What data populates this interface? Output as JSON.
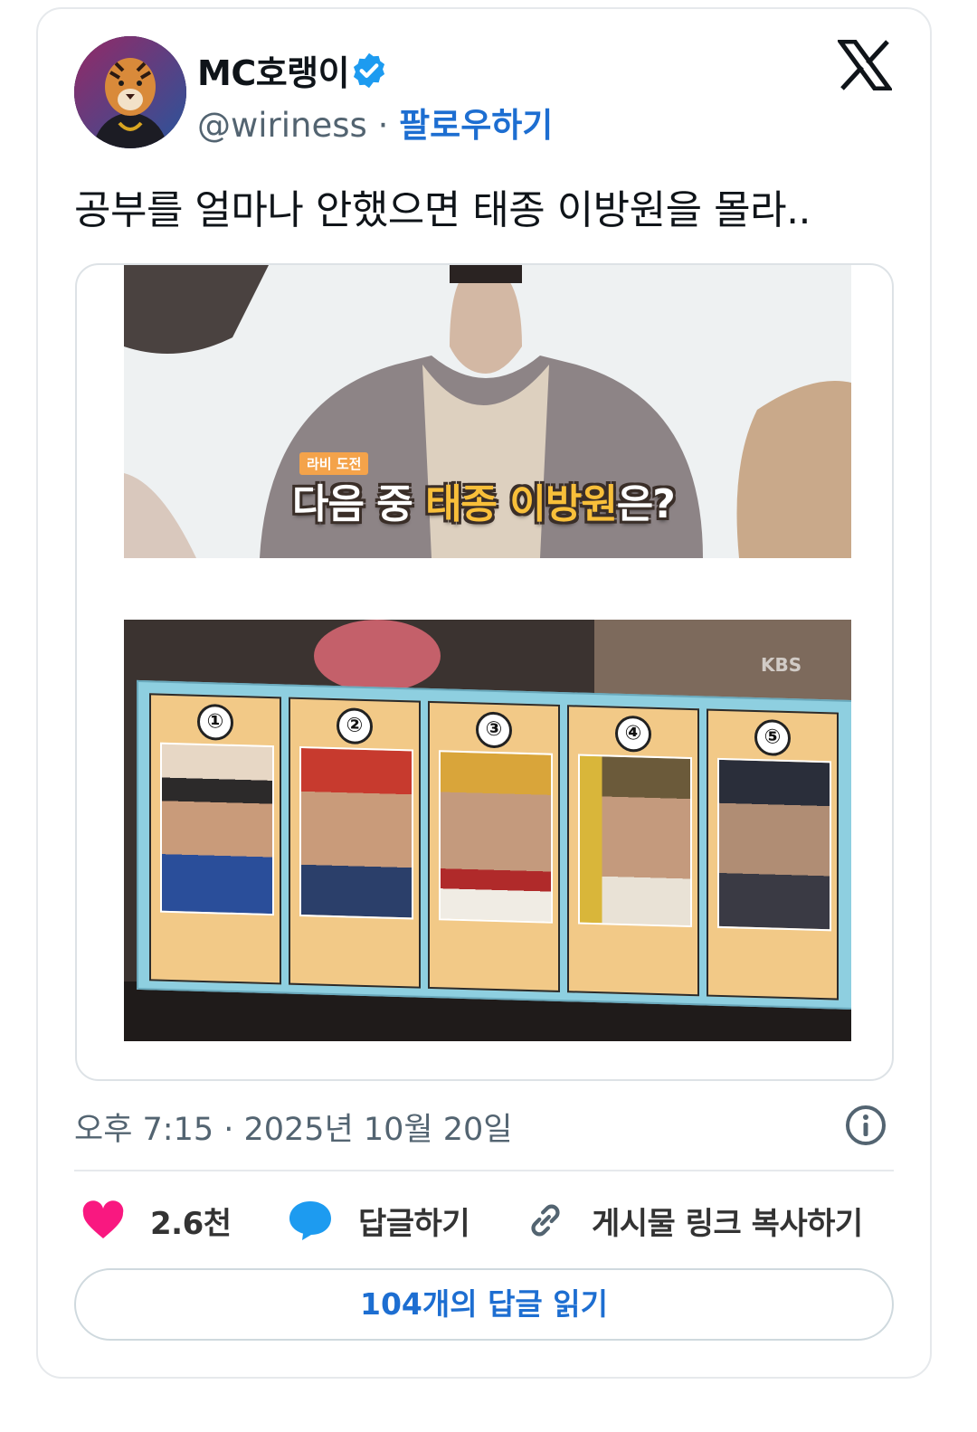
{
  "author": {
    "name": "MC호랭이",
    "handle": "@wiriness",
    "separator": "·",
    "follow_label": "팔로우하기"
  },
  "tweet": {
    "text": "공부를 얼마나 안했으면 태종 이방원을 몰라.."
  },
  "media": {
    "caption_tag": "라비 도전",
    "caption_prefix": "다음 중 ",
    "caption_highlight": "태종 이방원",
    "caption_suffix": "은?",
    "broadcaster": "KBS",
    "board_numbers": [
      "①",
      "②",
      "③",
      "④",
      "⑤"
    ]
  },
  "timestamp": "오후 7:15 · 2025년 10월 20일",
  "actions": {
    "likes": "2.6천",
    "reply_label": "답글하기",
    "copy_link_label": "게시물 링크 복사하기"
  },
  "read_replies_label": "104개의 답글 읽기",
  "colors": {
    "accent": "#1d6ed1",
    "verified": "#1d9bf0",
    "heart": "#f91880",
    "reply": "#1d9bf0",
    "caption_highlight": "#f8bf3a"
  }
}
